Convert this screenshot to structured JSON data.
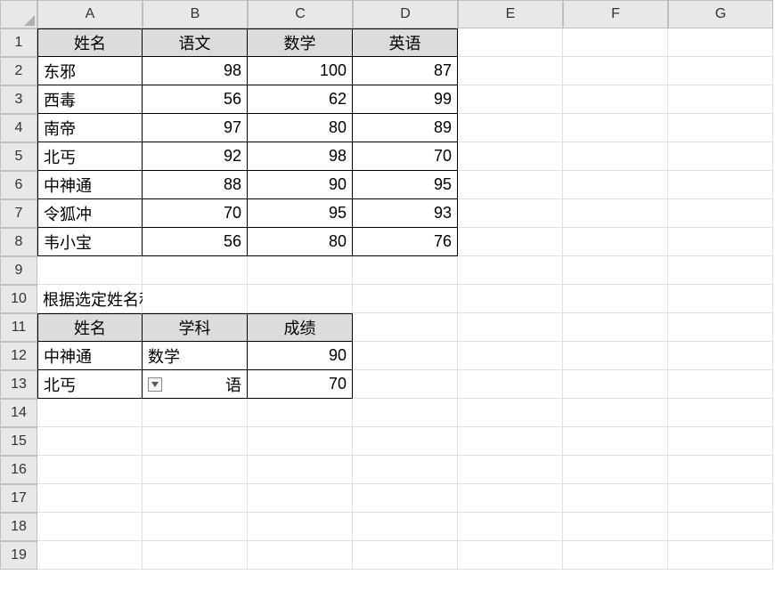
{
  "columns": [
    "A",
    "B",
    "C",
    "D",
    "E",
    "F",
    "G"
  ],
  "rows": [
    "1",
    "2",
    "3",
    "4",
    "5",
    "6",
    "7",
    "8",
    "9",
    "10",
    "11",
    "12",
    "13",
    "14",
    "15",
    "16",
    "17",
    "18",
    "19"
  ],
  "main_table": {
    "headers": [
      "姓名",
      "语文",
      "数学",
      "英语"
    ],
    "data": [
      {
        "name": "东邪",
        "chinese": 98,
        "math": 100,
        "english": 87
      },
      {
        "name": "西毒",
        "chinese": 56,
        "math": 62,
        "english": 99
      },
      {
        "name": "南帝",
        "chinese": 97,
        "math": 80,
        "english": 89
      },
      {
        "name": "北丐",
        "chinese": 92,
        "math": 98,
        "english": 70
      },
      {
        "name": "中神通",
        "chinese": 88,
        "math": 90,
        "english": 95
      },
      {
        "name": "令狐冲",
        "chinese": 70,
        "math": 95,
        "english": 93
      },
      {
        "name": "韦小宝",
        "chinese": 56,
        "math": 80,
        "english": 76
      }
    ]
  },
  "lookup": {
    "title": "根据选定姓名和学科查询成绩",
    "headers": [
      "姓名",
      "学科",
      "成绩"
    ],
    "rows": [
      {
        "name": "中神通",
        "subject": "数学",
        "score": 90
      },
      {
        "name": "北丐",
        "subject": "语",
        "score": 70
      }
    ]
  }
}
